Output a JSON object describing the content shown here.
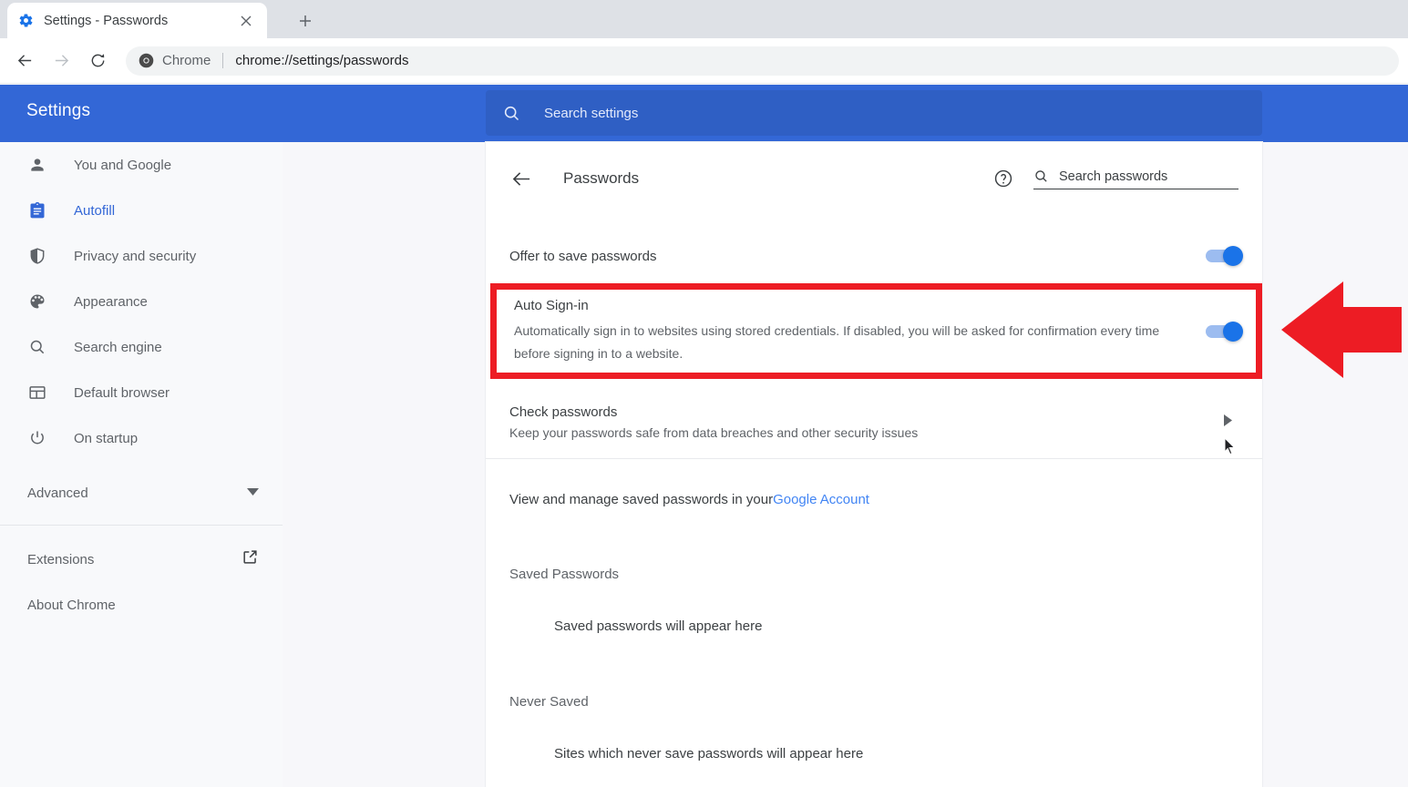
{
  "browser": {
    "tab": {
      "title": "Settings - Passwords",
      "favicon": "gear-icon",
      "close": "✕"
    },
    "new_tab": "+",
    "nav": {
      "back": "←",
      "forward": "→",
      "reload": "⟳"
    },
    "omnibox": {
      "scheme_label": "Chrome",
      "url": "chrome://settings/passwords",
      "icon": "chrome-icon"
    }
  },
  "settings_header": {
    "title": "Settings",
    "search": {
      "placeholder": "Search settings",
      "icon": "search-icon"
    }
  },
  "sidebar": {
    "items": [
      {
        "label": "You and Google",
        "icon": "person-icon",
        "active": false
      },
      {
        "label": "Autofill",
        "icon": "clipboard-icon",
        "active": true
      },
      {
        "label": "Privacy and security",
        "icon": "shield-icon",
        "active": false
      },
      {
        "label": "Appearance",
        "icon": "palette-icon",
        "active": false
      },
      {
        "label": "Search engine",
        "icon": "search-icon",
        "active": false
      },
      {
        "label": "Default browser",
        "icon": "browser-window-icon",
        "active": false
      },
      {
        "label": "On startup",
        "icon": "power-icon",
        "active": false
      }
    ],
    "advanced": {
      "label": "Advanced",
      "icon": "chevron-down-icon"
    },
    "extensions": {
      "label": "Extensions",
      "icon": "external-link-icon"
    },
    "about": {
      "label": "About Chrome"
    }
  },
  "page": {
    "title": "Passwords",
    "back_icon": "back-arrow-icon",
    "help_icon": "help-circle-icon",
    "search_passwords": {
      "placeholder": "Search passwords",
      "icon": "search-icon"
    },
    "offer_to_save": {
      "label": "Offer to save passwords",
      "toggle_state": "on"
    },
    "auto_signin": {
      "title": "Auto Sign-in",
      "description": "Automatically sign in to websites using stored credentials. If disabled, you will be asked for confirmation every time before signing in to a website.",
      "toggle_state": "on",
      "highlighted": true,
      "highlight_color": "#ed1c24"
    },
    "check_passwords": {
      "title": "Check passwords",
      "description": "Keep your passwords safe from data breaches and other security issues",
      "chevron": "chevron-right-icon"
    },
    "manage": {
      "text": "View and manage saved passwords in your ",
      "link": "Google Account"
    },
    "saved_passwords": {
      "heading": "Saved Passwords",
      "empty_text": "Saved passwords will appear here"
    },
    "never_saved": {
      "heading": "Never Saved",
      "empty_text": "Sites which never save passwords will appear here"
    }
  },
  "annotation": {
    "arrow": "left-arrow-annotation",
    "color": "#ed1c24"
  },
  "colors": {
    "accent_blue": "#3367d6",
    "toggle_blue": "#1a73e8",
    "link_blue": "#4285f4",
    "highlight_red": "#ed1c24"
  }
}
